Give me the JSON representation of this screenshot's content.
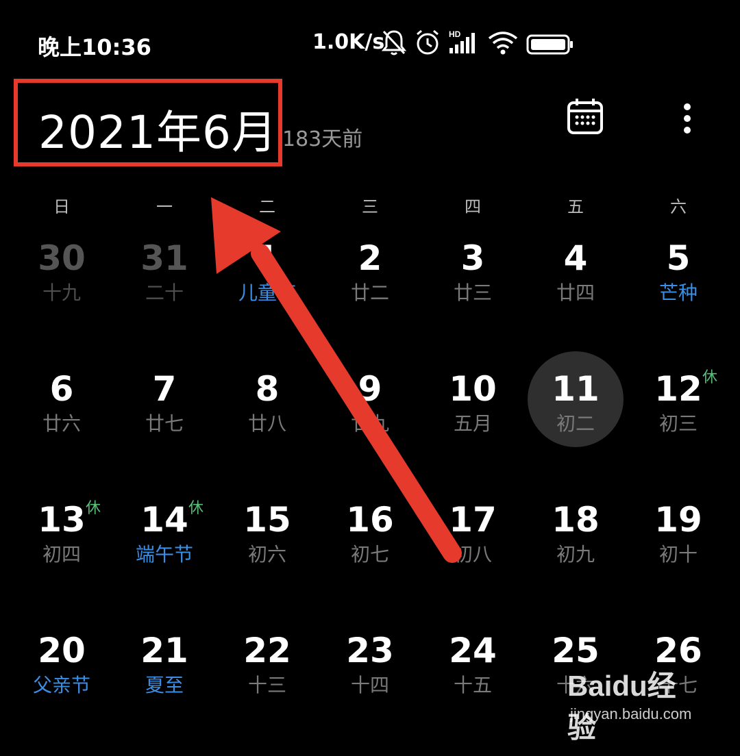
{
  "status_bar": {
    "time": "晚上10:36",
    "net_speed": "1.0K/s",
    "icons": [
      "bell-muted-icon",
      "alarm-icon",
      "hd-signal-icon",
      "wifi-icon",
      "battery-icon"
    ]
  },
  "header": {
    "month_title": "2021年6月",
    "days_ago": "183天前",
    "icons": [
      "calendar-icon",
      "more-vertical-icon"
    ]
  },
  "weekdays": [
    "日",
    "一",
    "二",
    "三",
    "四",
    "五",
    "六"
  ],
  "weeks": [
    [
      {
        "day": "30",
        "lunar": "十九",
        "other": true
      },
      {
        "day": "31",
        "lunar": "二十",
        "other": true
      },
      {
        "day": "1",
        "lunar": "儿童节",
        "festival": true
      },
      {
        "day": "2",
        "lunar": "廿二"
      },
      {
        "day": "3",
        "lunar": "廿三"
      },
      {
        "day": "4",
        "lunar": "廿四"
      },
      {
        "day": "5",
        "lunar": "芒种",
        "festival": true
      }
    ],
    [
      {
        "day": "6",
        "lunar": "廿六"
      },
      {
        "day": "7",
        "lunar": "廿七"
      },
      {
        "day": "8",
        "lunar": "廿八"
      },
      {
        "day": "9",
        "lunar": "廿九"
      },
      {
        "day": "10",
        "lunar": "五月"
      },
      {
        "day": "11",
        "lunar": "初二",
        "today": true
      },
      {
        "day": "12",
        "lunar": "初三",
        "rest": "休"
      }
    ],
    [
      {
        "day": "13",
        "lunar": "初四",
        "rest": "休"
      },
      {
        "day": "14",
        "lunar": "端午节",
        "festival": true,
        "rest": "休"
      },
      {
        "day": "15",
        "lunar": "初六"
      },
      {
        "day": "16",
        "lunar": "初七"
      },
      {
        "day": "17",
        "lunar": "初八"
      },
      {
        "day": "18",
        "lunar": "初九"
      },
      {
        "day": "19",
        "lunar": "初十"
      }
    ],
    [
      {
        "day": "20",
        "lunar": "父亲节",
        "festival": true
      },
      {
        "day": "21",
        "lunar": "夏至",
        "festival": true
      },
      {
        "day": "22",
        "lunar": "十三"
      },
      {
        "day": "23",
        "lunar": "十四"
      },
      {
        "day": "24",
        "lunar": "十五"
      },
      {
        "day": "25",
        "lunar": "十六"
      },
      {
        "day": "26",
        "lunar": "十七"
      }
    ]
  ],
  "watermark": {
    "brand": "Baidu经验",
    "url": "jingyan.baidu.com"
  },
  "colors": {
    "background": "#000000",
    "festival_blue": "#3a8ee6",
    "rest_green": "#5bbd7a",
    "annotation_red": "#e53a2c",
    "today_circle": "#2f2f2f"
  }
}
